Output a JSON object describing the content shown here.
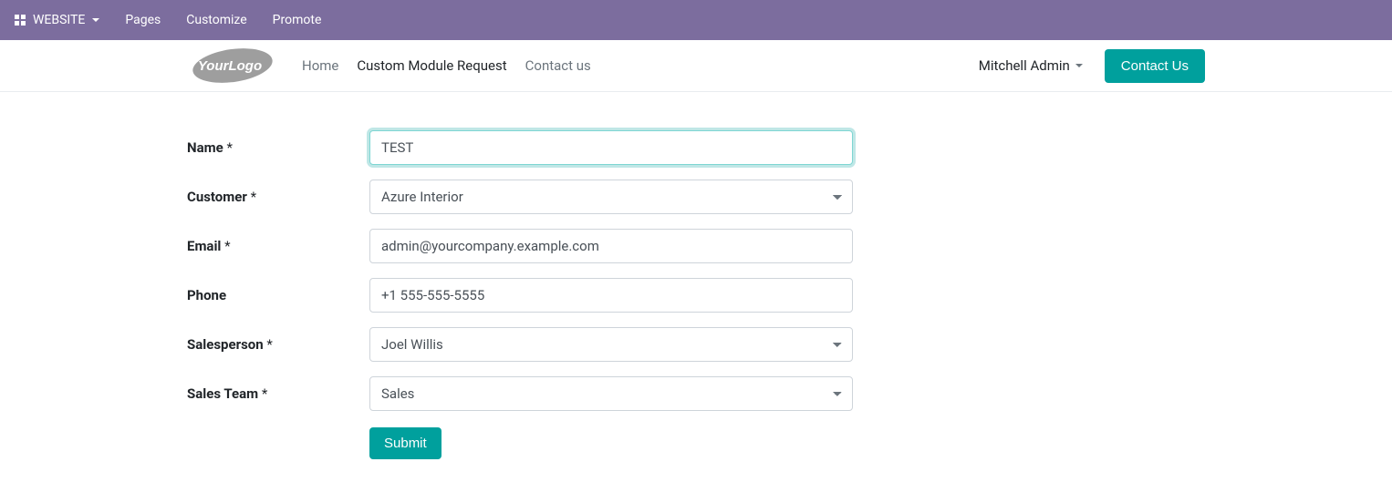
{
  "topbar": {
    "website_label": "WEBSITE",
    "items": [
      {
        "label": "Pages"
      },
      {
        "label": "Customize"
      },
      {
        "label": "Promote"
      }
    ]
  },
  "header": {
    "logo_text": "YourLogo",
    "nav": [
      {
        "label": "Home",
        "active": false
      },
      {
        "label": "Custom Module Request",
        "active": true
      },
      {
        "label": "Contact us",
        "active": false
      }
    ],
    "user_name": "Mitchell Admin",
    "contact_button": "Contact Us"
  },
  "form": {
    "fields": {
      "name": {
        "label": "Name",
        "required": true,
        "value": "TEST"
      },
      "customer": {
        "label": "Customer",
        "required": true,
        "value": "Azure Interior"
      },
      "email": {
        "label": "Email",
        "required": true,
        "value": "admin@yourcompany.example.com"
      },
      "phone": {
        "label": "Phone",
        "required": false,
        "value": "+1 555-555-5555"
      },
      "salesperson": {
        "label": "Salesperson",
        "required": true,
        "value": "Joel Willis"
      },
      "sales_team": {
        "label": "Sales Team",
        "required": true,
        "value": "Sales"
      }
    },
    "submit_label": "Submit"
  }
}
